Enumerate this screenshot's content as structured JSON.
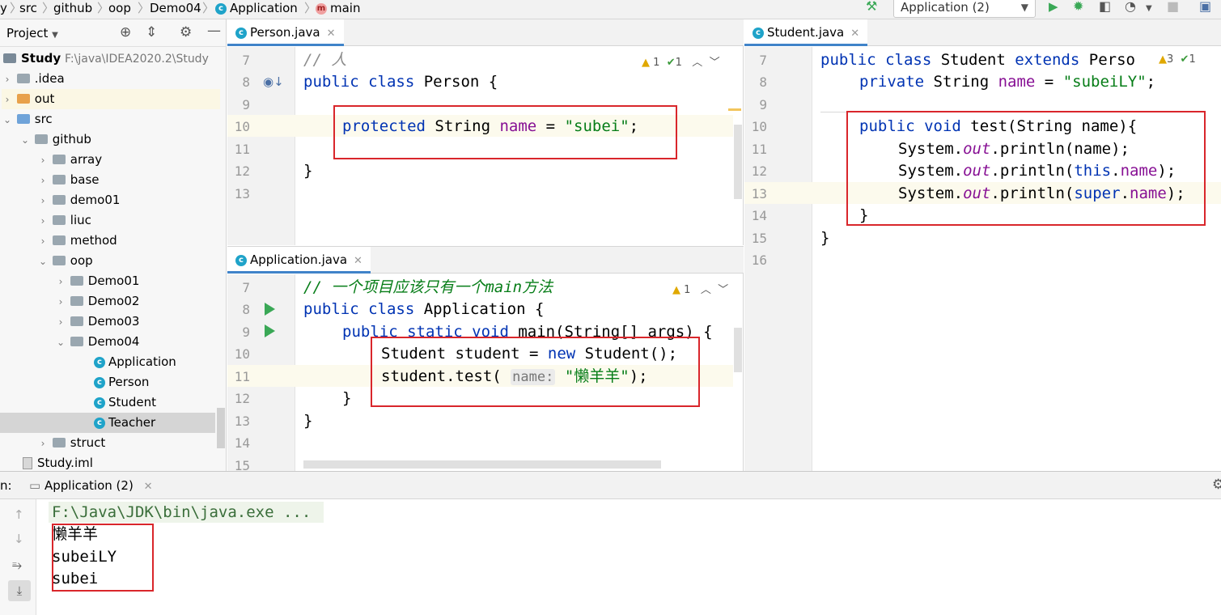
{
  "nav": {
    "crumbs": [
      "y",
      "src",
      "github",
      "oop",
      "Demo04",
      "Application",
      "main"
    ],
    "run_config": "Application (2)"
  },
  "project": {
    "title": "Project",
    "root_name": "Study",
    "root_path": "F:\\java\\IDEA2020.2\\Study",
    "items": [
      ".idea",
      "out",
      "src",
      "github",
      "array",
      "base",
      "demo01",
      "liuc",
      "method",
      "oop",
      "Demo01",
      "Demo02",
      "Demo03",
      "Demo04",
      "Application",
      "Person",
      "Student",
      "Teacher",
      "struct",
      "Study.iml"
    ]
  },
  "editors": {
    "person_tab": "Person.java",
    "application_tab": "Application.java",
    "student_tab": "Student.java",
    "person_lines": [
      "7",
      "8",
      "9",
      "10",
      "11",
      "12",
      "13"
    ],
    "application_lines": [
      "7",
      "8",
      "9",
      "10",
      "11",
      "12",
      "13",
      "14",
      "15"
    ],
    "student_lines": [
      "7",
      "8",
      "9",
      "10",
      "11",
      "12",
      "13",
      "14",
      "15",
      "16"
    ],
    "person_warn": "1",
    "person_ok": "1",
    "application_warn": "1",
    "student_warn": "3",
    "student_ok": "1",
    "person_code": {
      "l7": "// 人",
      "l8a": "public class",
      "l8b": " Person {",
      "l10a": "protected",
      "l10b": " String ",
      "l10c": "name",
      "l10d": " = ",
      "l10e": "\"subei\"",
      "l10f": ";",
      "l12": "}"
    },
    "application_code": {
      "l7": "// 一个项目应该只有一个main方法",
      "l8a": "public class",
      "l8b": " Application {",
      "l9a": "public static void",
      "l9b": " main(String[] args) {",
      "l10a": "Student student = ",
      "l10b": "new",
      "l10c": " Student();",
      "l11a": "student.test(",
      "l11hint": "name:",
      "l11b": "\"懒羊羊\"",
      "l11c": ");",
      "l12": "}",
      "l13": "}"
    },
    "student_code": {
      "l7a": "public class",
      "l7b": " Student ",
      "l7c": "extends",
      "l7d": " Perso",
      "l8a": "private",
      "l8b": " String ",
      "l8c": "name",
      "l8d": " = ",
      "l8e": "\"subeiLY\"",
      "l8f": ";",
      "l10a": "public void",
      "l10b": " test(String name){",
      "l11a": "System.",
      "l11b": "out",
      "l11c": ".println(name);",
      "l12a": "System.",
      "l12b": "out",
      "l12c": ".println(",
      "l12d": "this",
      "l12e": ".",
      "l12f": "name",
      "l12g": ");",
      "l13a": "System.",
      "l13b": "out",
      "l13c": ".println(",
      "l13d": "super",
      "l13e": ".",
      "l13f": "name",
      "l13g": ");",
      "l14": "}",
      "l15": "}"
    }
  },
  "run": {
    "label": "n:",
    "tab": "Application (2)",
    "command": "F:\\Java\\JDK\\bin\\java.exe ...",
    "output": [
      "懒羊羊",
      "subeiLY",
      "subei"
    ]
  }
}
